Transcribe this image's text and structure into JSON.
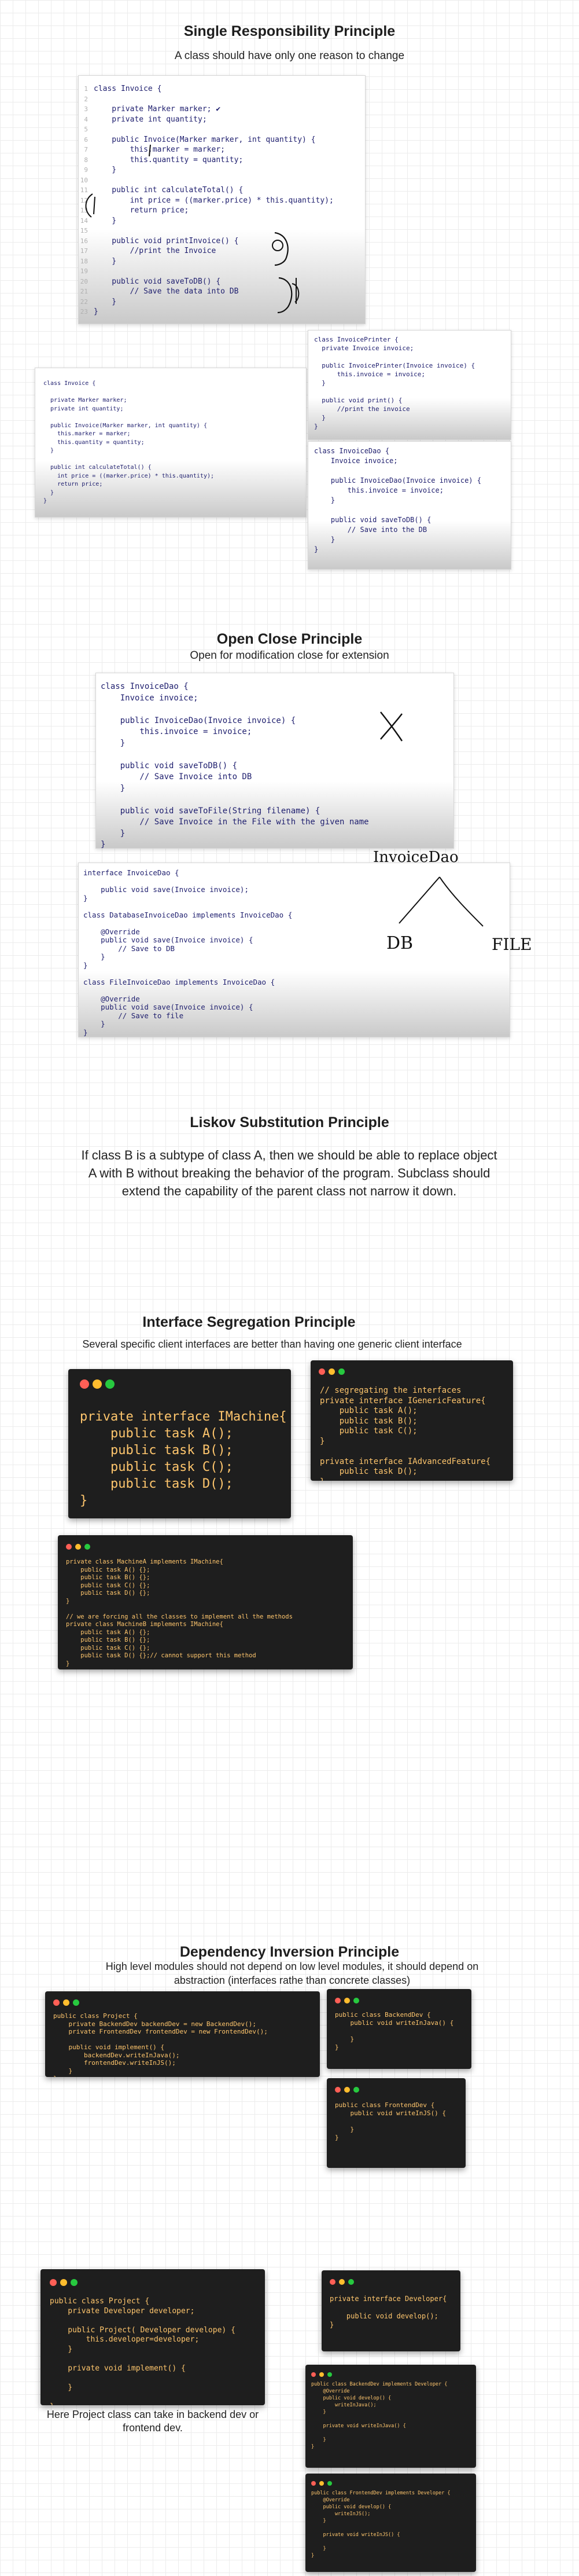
{
  "srp": {
    "title": "Single Responsibility Principle",
    "subtitle": "A class should have only one reason to change",
    "main_code": "class Invoice {\n\n    private Marker marker; ✔\n    private int quantity;\n\n    public Invoice(Marker marker, int quantity) {\n        this.marker = marker;\n        this.quantity = quantity;\n    }\n\n    public int calculateTotal() {\n        int price = ((marker.price) * this.quantity);\n        return price;\n    }\n\n    public void printInvoice() {\n        //print the Invoice\n    }\n\n    public void saveToDB() {\n        // Save the data into DB\n    }\n}",
    "main_lines": "1\n2\n3\n4\n5\n6\n7\n8\n9\n10\n11\n12\n13\n14\n15\n16\n17\n18\n19\n20\n21\n22\n23",
    "small_code": "class Invoice {\n\n  private Marker marker;\n  private int quantity;\n\n  public Invoice(Marker marker, int quantity) {\n    this.marker = marker;\n    this.quantity = quantity;\n  }\n\n  public int calculateTotal() {\n    int price = ((marker.price) * this.quantity);\n    return price;\n  }\n}",
    "printer_code": "class InvoicePrinter {\n  private Invoice invoice;\n\n  public InvoicePrinter(Invoice invoice) {\n      this.invoice = invoice;\n  }\n\n  public void print() {\n      //print the invoice\n  }\n}",
    "dao_code": "class InvoiceDao {\n    Invoice invoice;\n\n    public InvoiceDao(Invoice invoice) {\n        this.invoice = invoice;\n    }\n\n    public void saveToDB() {\n        // Save into the DB\n    }\n}"
  },
  "ocp": {
    "title": "Open Close Principle",
    "subtitle": "Open for modification close for extension",
    "dao_code": "class InvoiceDao {\n    Invoice invoice;\n\n    public InvoiceDao(Invoice invoice) {\n        this.invoice = invoice;\n    }\n\n    public void saveToDB() {\n        // Save Invoice into DB\n    }\n\n    public void saveToFile(String filename) {\n        // Save Invoice in the File with the given name\n    }\n}",
    "iface_code": "interface InvoiceDao {\n\n    public void save(Invoice invoice);\n}\n\nclass DatabaseInvoiceDao implements InvoiceDao {\n\n    @Override\n    public void save(Invoice invoice) {\n        // Save to DB\n    }\n}\n\nclass FileInvoiceDao implements InvoiceDao {\n\n    @Override\n    public void save(Invoice invoice) {\n        // Save to file\n    }\n}",
    "hand_top": "InvoiceDao",
    "hand_db": "DB",
    "hand_file": "FILE"
  },
  "lsp": {
    "title": "Liskov Substitution Principle",
    "text": "If class B is a subtype of class A, then we should be able to replace object A with B without breaking the behavior of the program. Subclass should extend the capability of the parent class not narrow it down."
  },
  "isp": {
    "title": "Interface Segregation Principle",
    "subtitle": "Several specific client interfaces are better than having one generic client interface",
    "imachine_code": "private interface IMachine{\n    public task A();\n    public task B();\n    public task C();\n    public task D();\n}",
    "segregated_code": "// segregating the interfaces\nprivate interface IGenericFeature{\n    public task A();\n    public task B();\n    public task C();\n}\n\nprivate interface IAdvancedFeature{\n    public task D();\n}",
    "machines_code": "private class MachineA implements IMachine{\n    public task A() {};\n    public task B() {};\n    public task C() {};\n    public task D() {};\n}\n\n// we are forcing all the classes to implement all the methods\nprivate class MachineB implements IMachine{\n    public task A() {};\n    public task B() {};\n    public task C() {};\n    public task D() {};// cannot support this method\n}"
  },
  "dip": {
    "title": "Dependency  Inversion Principle",
    "subtitle": "High level modules should not depend on low level modules, it should depend on abstraction (interfaces rathe than concrete classes)",
    "project_code": "public class Project {\n    private BackendDev backendDev = new BackendDev();\n    private FrontendDev frontendDev = new FrontendDev();\n\n    public void implement() {\n        backendDev.writeInJava();\n        frontendDev.writeInJS();\n    }\n}",
    "backend_code": "public class BackendDev {\n    public void writeInJava() {\n\n    }\n}",
    "frontend_code": "public class FrontendDev {\n    public void writeInJS() {\n\n    }\n}",
    "project2_code": "public class Project {\n    private Developer developer;\n\n    public Project( Developer develope) {\n        this.developer=developer;\n    }\n\n    private void implement() {\n\n    }\n\n}",
    "developer_code": "private interface Developer{\n\n    public void develop();\n}",
    "backend2_code": "public class BackendDev implements Developer {\n    @Override\n    public void develop() {\n        writeInJava();\n    }\n\n    private void writeInJava() {\n\n    }\n}",
    "frontend2_code": "public class FrontendDev implements Developer {\n    @Override\n    public void develop() {\n        writeInJS();\n    }\n\n    private void writeInJS() {\n\n    }\n}",
    "caption": "Here Project class can take in backend dev or frontend dev."
  },
  "colors": {
    "background": "#ffffff",
    "grid": "#ececec",
    "dark_card": "#1e1e1e",
    "light_code": "#1e1e6e",
    "keyword_dark": "#ffc66d",
    "type_dark": "#4fc1ff",
    "highlight": "#fde7c4"
  }
}
